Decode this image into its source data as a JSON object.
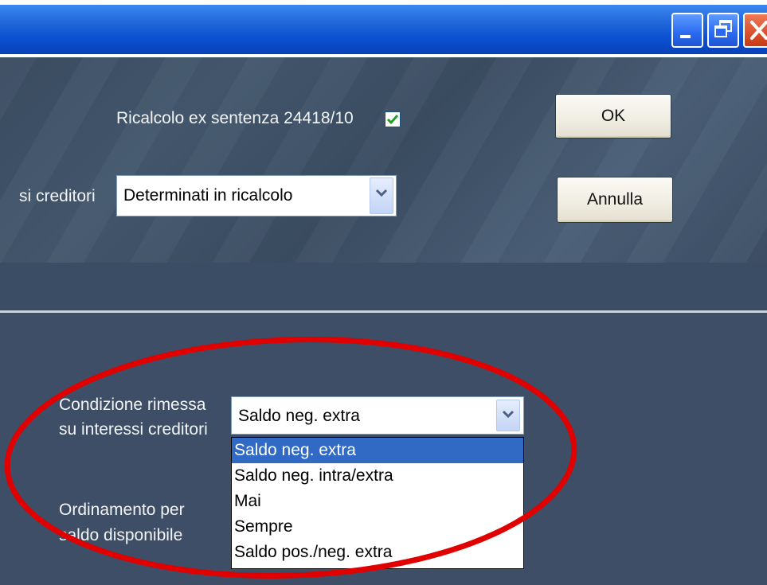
{
  "window": {
    "controls": {
      "minimize_icon": "minimize-icon",
      "restore_icon": "restore-icon",
      "close_icon": "close-icon"
    }
  },
  "form": {
    "recalc_label": "Ricalcolo ex sentenza 24418/10",
    "recalc_checked": true,
    "creditors_label": "si creditori",
    "creditors_value": "Determinati in ricalcolo",
    "ok_label": "OK",
    "cancel_label": "Annulla",
    "condition_label_line1": "Condizione rimessa",
    "condition_label_line2": "su interessi creditori",
    "condition_value": "Saldo neg. extra",
    "condition_options": [
      "Saldo neg. extra",
      "Saldo neg. intra/extra",
      "Mai",
      "Sempre",
      "Saldo pos./neg. extra"
    ],
    "condition_selected_index": 0,
    "ordering_label_line1": "Ordinamento per",
    "ordering_label_line2": "saldo disponibile"
  },
  "colors": {
    "titlebar": "#0a4fd0",
    "panel": "#3d4e66",
    "selection": "#316ac5",
    "annotation": "#e00000"
  }
}
